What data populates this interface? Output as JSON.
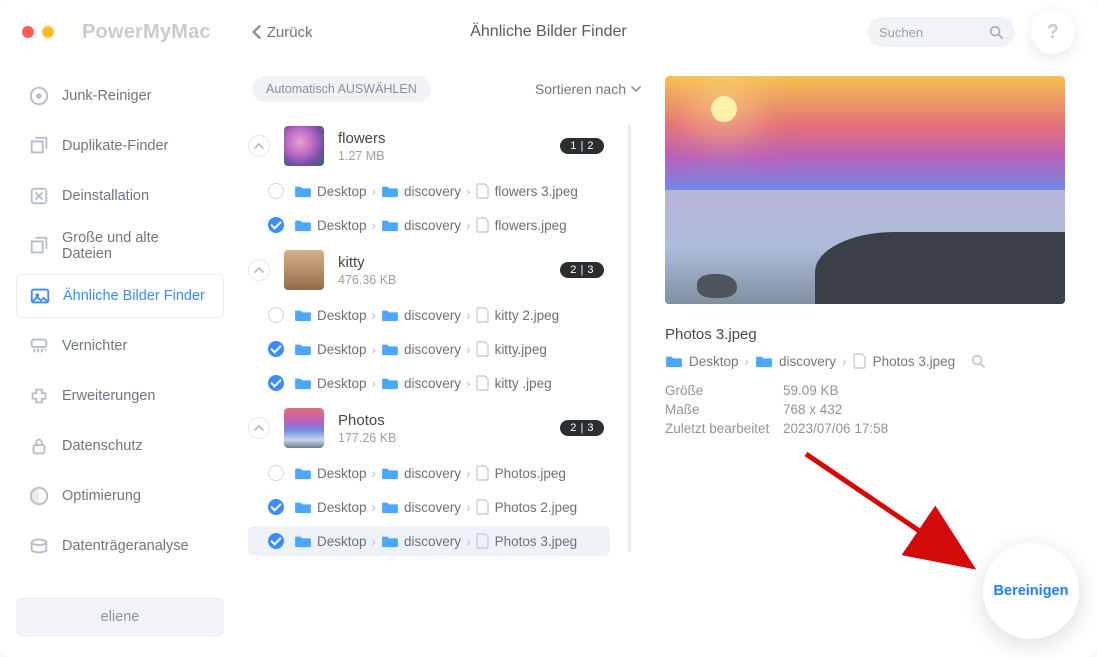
{
  "header": {
    "brand": "PowerMyMac",
    "back_label": "Zurück",
    "title": "Ähnliche Bilder Finder",
    "search_placeholder": "Suchen",
    "traffic_colors": {
      "red": "#ff5f57",
      "yellow": "#febc2e"
    }
  },
  "sidebar": {
    "items": [
      {
        "id": "junk",
        "label": "Junk-Reiniger"
      },
      {
        "id": "duplicate",
        "label": "Duplikate-Finder"
      },
      {
        "id": "uninstall",
        "label": "Deinstallation"
      },
      {
        "id": "large",
        "label": "Große und alte Dateien"
      },
      {
        "id": "similar",
        "label": "Ähnliche Bilder Finder"
      },
      {
        "id": "shredder",
        "label": "Vernichter"
      },
      {
        "id": "extensions",
        "label": "Erweiterungen"
      },
      {
        "id": "privacy",
        "label": "Datenschutz"
      },
      {
        "id": "optimize",
        "label": "Optimierung"
      },
      {
        "id": "disk",
        "label": "Datenträgeranalyse"
      }
    ],
    "selected_id": "similar",
    "user_label": "eliene"
  },
  "center": {
    "auto_select_label": "Automatisch AUSWÄHLEN",
    "sort_label": "Sortieren nach",
    "groups": [
      {
        "name": "flowers",
        "size": "1.27 MB",
        "badge": "1 | 2",
        "thumb_class": "flowers",
        "files": [
          {
            "checked": false,
            "path": [
              "Desktop",
              "discovery"
            ],
            "filename": "flowers 3.jpeg",
            "highlight": false
          },
          {
            "checked": true,
            "path": [
              "Desktop",
              "discovery"
            ],
            "filename": "flowers.jpeg",
            "highlight": false
          }
        ]
      },
      {
        "name": "kitty",
        "size": "476.36 KB",
        "badge": "2 | 3",
        "thumb_class": "kitty",
        "files": [
          {
            "checked": false,
            "path": [
              "Desktop",
              "discovery"
            ],
            "filename": "kitty 2.jpeg",
            "highlight": false
          },
          {
            "checked": true,
            "path": [
              "Desktop",
              "discovery"
            ],
            "filename": "kitty.jpeg",
            "highlight": false
          },
          {
            "checked": true,
            "path": [
              "Desktop",
              "discovery"
            ],
            "filename": "kitty .jpeg",
            "highlight": false
          }
        ]
      },
      {
        "name": "Photos",
        "size": "177.26 KB",
        "badge": "2 | 3",
        "thumb_class": "photos",
        "files": [
          {
            "checked": false,
            "path": [
              "Desktop",
              "discovery"
            ],
            "filename": "Photos.jpeg",
            "highlight": false
          },
          {
            "checked": true,
            "path": [
              "Desktop",
              "discovery"
            ],
            "filename": "Photos 2.jpeg",
            "highlight": false
          },
          {
            "checked": true,
            "path": [
              "Desktop",
              "discovery"
            ],
            "filename": "Photos 3.jpeg",
            "highlight": true
          }
        ]
      }
    ]
  },
  "preview": {
    "filename": "Photos 3.jpeg",
    "path": [
      "Desktop",
      "discovery",
      "Photos 3.jpeg"
    ],
    "meta": {
      "size_key": "Größe",
      "size_val": "59.09 KB",
      "dims_key": "Maße",
      "dims_val": "768 x 432",
      "modified_key": "Zuletzt bearbeitet",
      "modified_val": "2023/07/06 17:58"
    }
  },
  "clean_button_label": "Bereinigen",
  "colors": {
    "accent": "#3c8cff",
    "arrow": "#d40a0a"
  }
}
